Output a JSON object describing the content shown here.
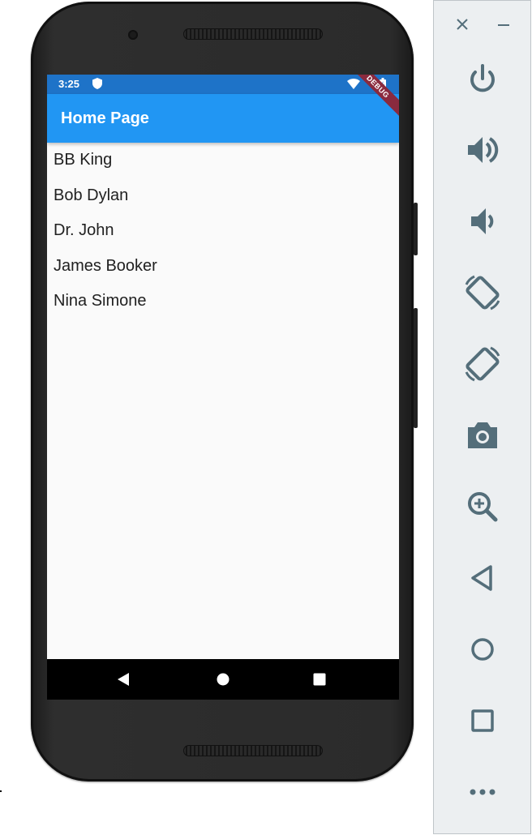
{
  "status_bar": {
    "time": "3:25"
  },
  "app_bar": {
    "title": "Home Page",
    "debug_banner": "DEBUG"
  },
  "list": {
    "items": [
      "BB King",
      "Bob Dylan",
      "Dr. John",
      "James Booker",
      "Nina Simone"
    ]
  },
  "colors": {
    "app_bar": "#2196f3",
    "status_bar": "#1e73c8",
    "screen_bg": "#fafafa",
    "debug_ribbon": "#8a2a3e",
    "sidebar_icon": "#546e7a"
  },
  "sidebar": {
    "buttons": [
      "close-icon",
      "minimize-icon",
      "power-icon",
      "volume-up-icon",
      "volume-down-icon",
      "rotate-left-icon",
      "rotate-right-icon",
      "camera-icon",
      "zoom-icon",
      "back-icon",
      "home-icon",
      "overview-icon",
      "more-icon"
    ]
  }
}
